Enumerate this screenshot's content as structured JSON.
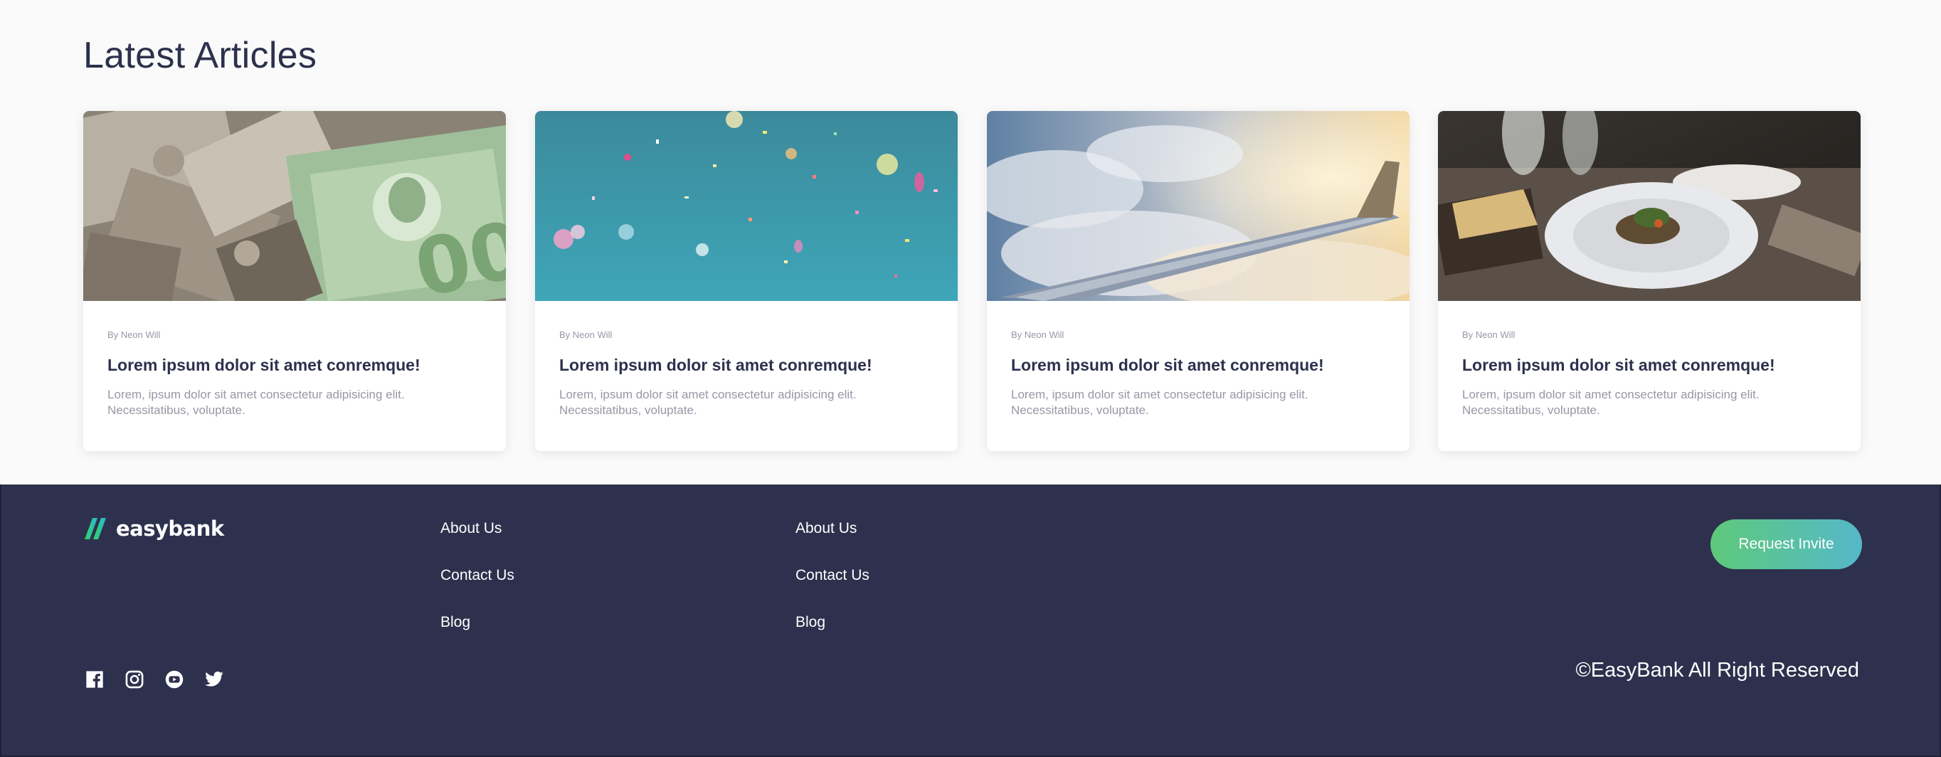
{
  "articles": {
    "title": "Latest Articles",
    "cards": [
      {
        "image": "canadian-banknotes-photo",
        "author": "By Neon Will",
        "title": "Lorem ipsum dolor sit amet conremque!",
        "desc_line1": "Lorem, ipsum dolor sit amet consectetur adipisicing elit.",
        "desc_line2": "Necessitatibus, voluptate."
      },
      {
        "image": "confetti-photo",
        "author": "By Neon Will",
        "title": "Lorem ipsum dolor sit amet conremque!",
        "desc_line1": "Lorem, ipsum dolor sit amet consectetur adipisicing elit.",
        "desc_line2": "Necessitatibus, voluptate."
      },
      {
        "image": "airplane-wing-photo",
        "author": "By Neon Will",
        "title": "Lorem ipsum dolor sit amet conremque!",
        "desc_line1": "Lorem, ipsum dolor sit amet consectetur adipisicing elit.",
        "desc_line2": "Necessitatibus, voluptate."
      },
      {
        "image": "restaurant-plate-photo",
        "author": "By Neon Will",
        "title": "Lorem ipsum dolor sit amet conremque!",
        "desc_line1": "Lorem, ipsum dolor sit amet consectetur adipisicing elit.",
        "desc_line2": "Necessitatibus, voluptate."
      }
    ]
  },
  "footer": {
    "logo_text": "easybank",
    "links_col1": [
      "About Us",
      "Contact Us",
      "Blog"
    ],
    "links_col2": [
      "About Us",
      "Contact Us",
      "Blog"
    ],
    "socials": [
      "facebook-icon",
      "instagram-icon",
      "youtube-icon",
      "twitter-icon"
    ],
    "cta_label": "Request Invite",
    "copyright": "©EasyBank All Right Reserved"
  },
  "colors": {
    "dark_blue": "#2d314d",
    "grayish_blue": "#9698a6",
    "lime_green": "#31d35c",
    "bright_cyan": "#2bb7da",
    "background": "#fafafa"
  }
}
